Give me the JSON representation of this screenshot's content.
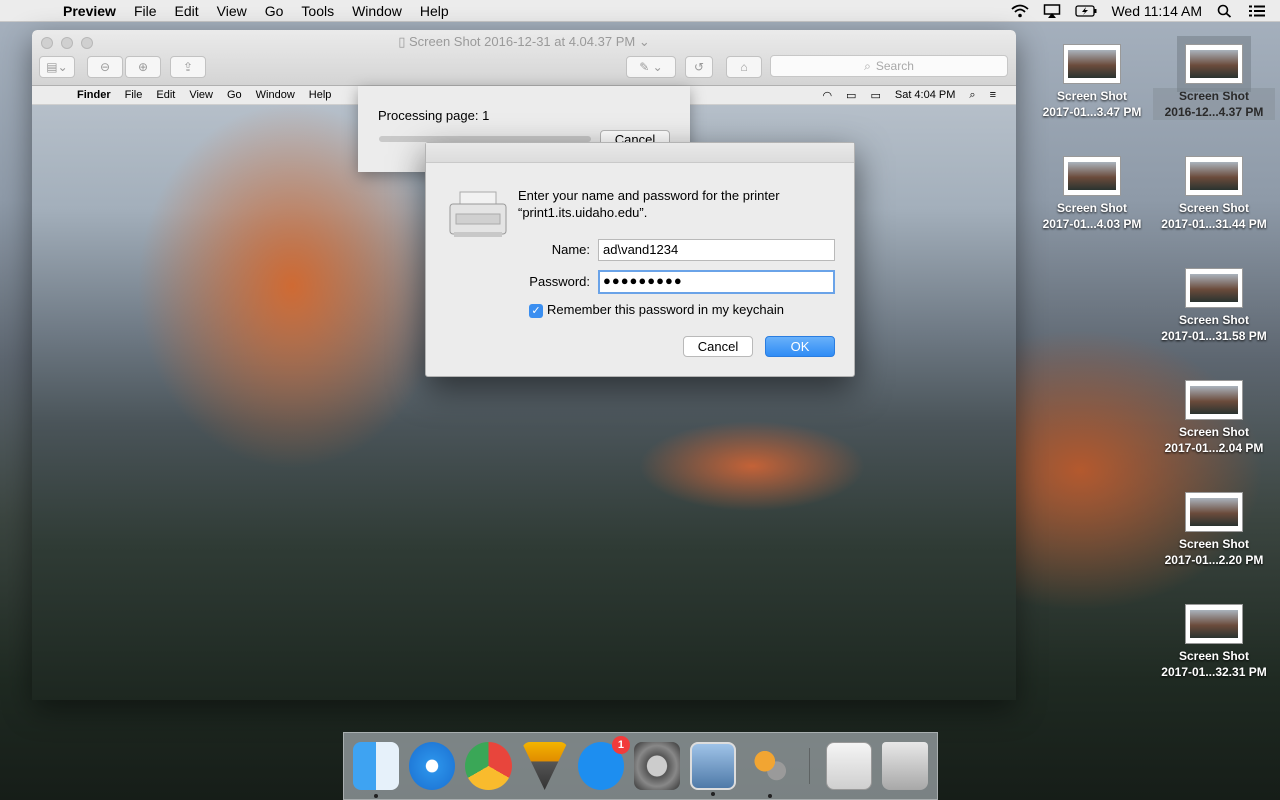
{
  "menubar": {
    "app": "Preview",
    "items": [
      "File",
      "Edit",
      "View",
      "Go",
      "Tools",
      "Window",
      "Help"
    ],
    "clock": "Wed 11:14 AM"
  },
  "preview_window": {
    "title": "Screen Shot 2016-12-31 at 4.04.37 PM",
    "search_placeholder": "Search"
  },
  "inner_menubar": {
    "app": "Finder",
    "items": [
      "File",
      "Edit",
      "View",
      "Go",
      "Window",
      "Help"
    ],
    "clock": "Sat 4:04 PM"
  },
  "progress": {
    "text": "Processing page: 1",
    "cancel": "Cancel",
    "fraction": 0.0
  },
  "dialog": {
    "message": "Enter your name and password for the printer “print1.its.uidaho.edu”.",
    "name_label": "Name:",
    "name_value": "ad\\vand1234",
    "password_label": "Password:",
    "password_value": "●●●●●●●●●",
    "remember_label": "Remember this password in my keychain",
    "cancel": "Cancel",
    "ok": "OK"
  },
  "desktop_icons": [
    {
      "line1": "Screen Shot",
      "line2": "2017-01...3.47 PM"
    },
    {
      "line1": "Screen Shot",
      "line2": "2016-12...4.37 PM"
    },
    {
      "line1": "Screen Shot",
      "line2": "2017-01...4.03 PM"
    },
    {
      "line1": "Screen Shot",
      "line2": "2017-01...31.44 PM"
    },
    {
      "line1": "Screen Shot",
      "line2": "2017-01...31.58 PM"
    },
    {
      "line1": "Screen Shot",
      "line2": "2017-01...2.04 PM"
    },
    {
      "line1": "Screen Shot",
      "line2": "2017-01...2.20 PM"
    },
    {
      "line1": "Screen Shot",
      "line2": "2017-01...32.31 PM"
    }
  ],
  "dock": {
    "app_store_badge": "1",
    "inner_app_store_badge": "1"
  }
}
